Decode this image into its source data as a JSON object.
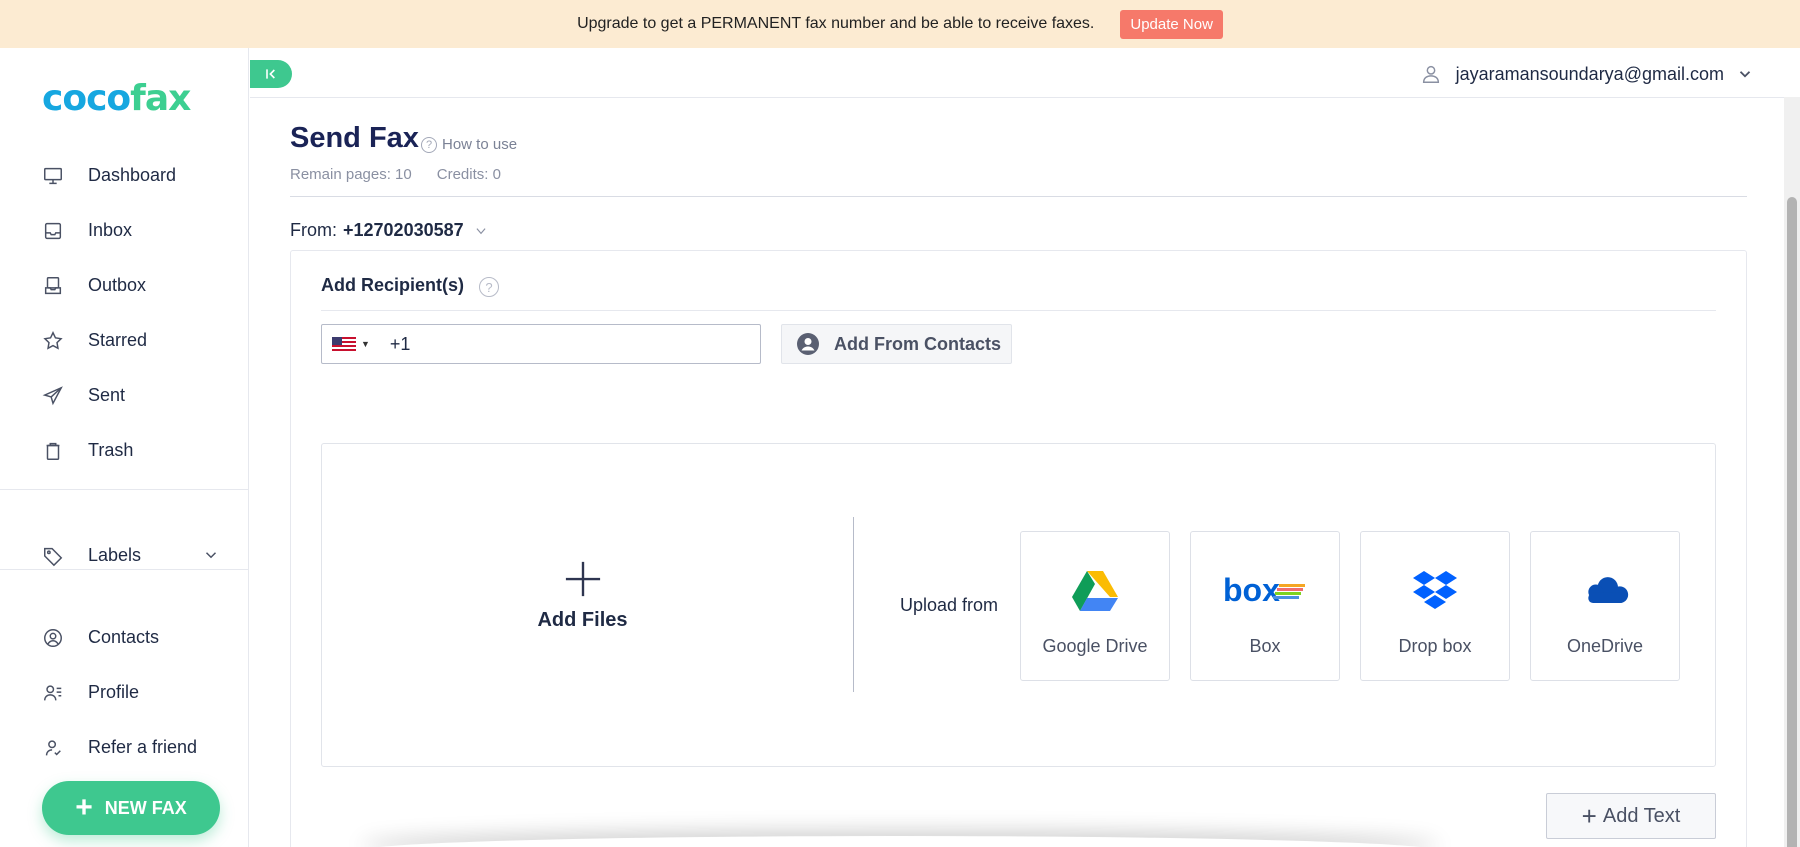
{
  "banner": {
    "text": "Upgrade to get a PERMANENT fax number and be able to receive faxes.",
    "button_label": "Update Now"
  },
  "logo": {
    "part1": "coco",
    "part2": "fax"
  },
  "sidebar": {
    "items": [
      {
        "label": "Dashboard",
        "icon": "monitor-icon"
      },
      {
        "label": "Inbox",
        "icon": "inbox-icon"
      },
      {
        "label": "Outbox",
        "icon": "outbox-icon"
      },
      {
        "label": "Starred",
        "icon": "star-icon"
      },
      {
        "label": "Sent",
        "icon": "send-icon"
      },
      {
        "label": "Trash",
        "icon": "trash-icon"
      }
    ],
    "labels": {
      "label": "Labels",
      "icon": "tag-icon"
    },
    "items2": [
      {
        "label": "Contacts",
        "icon": "contacts-icon"
      },
      {
        "label": "Profile",
        "icon": "profile-icon"
      },
      {
        "label": "Refer a friend",
        "icon": "refer-icon"
      }
    ],
    "new_fax_label": "NEW FAX"
  },
  "header": {
    "user_email": "jayaramansoundarya@gmail.com"
  },
  "main": {
    "title": "Send Fax",
    "how_to": "How to use",
    "remain_pages": "Remain pages: 10",
    "credits": "Credits: 0",
    "from_label": "From:",
    "from_number": "+12702030587",
    "recipients_title": "Add Recipient(s)",
    "phone_value": "+1",
    "add_contacts_label": "Add From Contacts",
    "add_files_label": "Add Files",
    "upload_from_label": "Upload from",
    "providers": [
      {
        "label": "Google Drive",
        "icon": "google-drive-icon"
      },
      {
        "label": "Box",
        "icon": "box-icon"
      },
      {
        "label": "Drop box",
        "icon": "dropbox-icon"
      },
      {
        "label": "OneDrive",
        "icon": "onedrive-icon"
      }
    ],
    "add_text_label": "Add Text"
  },
  "colors": {
    "accent": "#3ec88f",
    "banner_bg": "#fcebd2",
    "banner_button": "#f6796a",
    "title": "#1a2356"
  }
}
